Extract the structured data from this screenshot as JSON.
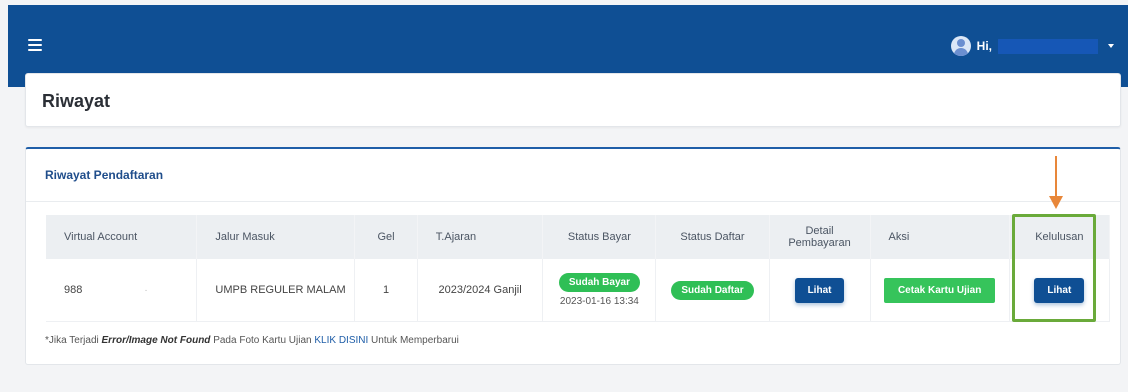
{
  "topbar": {
    "menu_icon": "hamburger-icon",
    "greeting": "Hi,",
    "avatar_icon": "user-avatar-icon",
    "dropdown_icon": "caret-down-icon"
  },
  "page": {
    "title": "Riwayat"
  },
  "card": {
    "title": "Riwayat Pendaftaran",
    "columns": {
      "virtual_account": "Virtual Account",
      "jalur_masuk": "Jalur Masuk",
      "gel": "Gel",
      "tajaran": "T.Ajaran",
      "status_bayar": "Status Bayar",
      "status_daftar": "Status Daftar",
      "detail_pembayaran": "Detail Pembayaran",
      "aksi": "Aksi",
      "kelulusan": "Kelulusan"
    },
    "row": {
      "virtual_account": "988",
      "jalur_masuk": "UMPB REGULER MALAM",
      "gel": "1",
      "tajaran": "2023/2024 Ganjil",
      "status_bayar": "Sudah Bayar",
      "status_bayar_time": "2023-01-16 13:34",
      "status_daftar": "Sudah Daftar",
      "detail_button": "Lihat",
      "aksi_button": "Cetak Kartu Ujian",
      "kelulusan_button": "Lihat"
    },
    "footnote": {
      "prefix": "*Jika Terjadi ",
      "emphasis": "Error/Image Not Found",
      "middle": " Pada Foto Kartu Ujian ",
      "link": "KLIK DISINI",
      "suffix": " Untuk Memperbarui"
    }
  },
  "colors": {
    "topbar": "#0f4f94",
    "success": "#2fbf56",
    "highlight": "#6aaa3a",
    "arrow": "#e8873a"
  }
}
